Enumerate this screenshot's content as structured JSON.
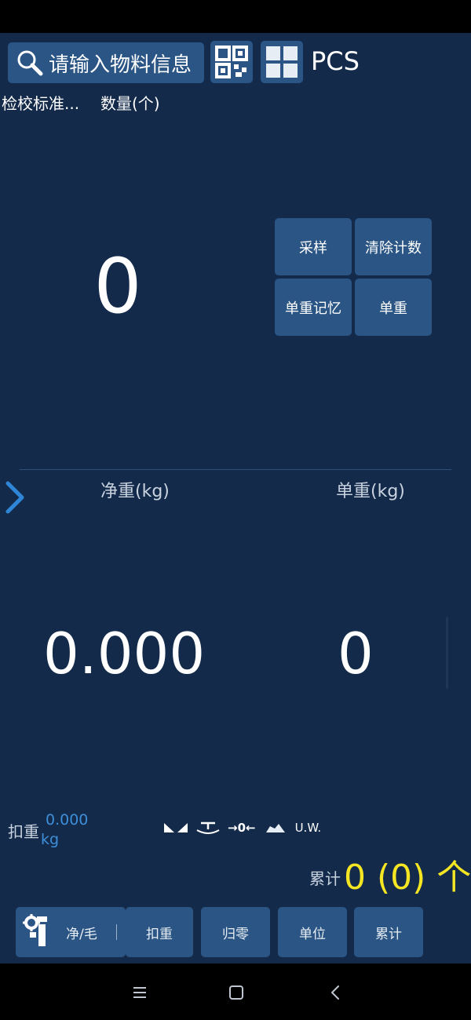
{
  "top_bar": {
    "search_label": "请输入物料信息",
    "unit": "PCS"
  },
  "subheader": {
    "standard": "检校标准...",
    "quantity_label": "数量(个)"
  },
  "quantity_value": "0",
  "function_buttons": {
    "sample": "采样",
    "clear_count": "清除计数",
    "unit_weight_memory": "单重记忆",
    "unit_weight": "单重"
  },
  "weight_panel": {
    "net_label": "净重(kg)",
    "net_value": "0.000",
    "unit_weight_label": "单重(kg)",
    "unit_weight_value": "0"
  },
  "tare": {
    "label": "扣重",
    "value": "0.000",
    "unit": "kg"
  },
  "status_indicators": {
    "zero": "→0←",
    "uw": "U.W."
  },
  "accumulate": {
    "label": "累计",
    "value": "0 (0) 个"
  },
  "bottom_buttons": {
    "net_gross": "净/毛",
    "tare": "扣重",
    "zero": "归零",
    "unit": "单位",
    "accumulate": "累计"
  },
  "colors": {
    "background": "#132a4a",
    "button": "#2a5584",
    "accent_blue": "#3d8fd9",
    "accumulate_yellow": "#f5e623"
  }
}
